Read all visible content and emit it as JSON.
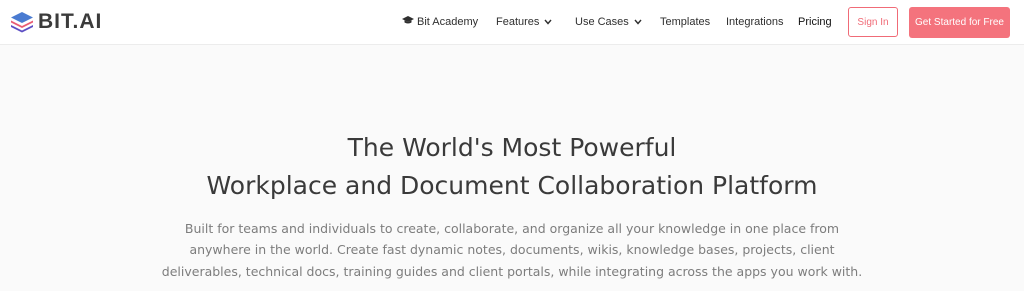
{
  "brand": {
    "logo_text": "BIT.AI"
  },
  "nav": {
    "academy": "Bit Academy",
    "features": "Features",
    "use_cases": "Use Cases",
    "templates": "Templates",
    "integrations": "Integrations",
    "pricing": "Pricing"
  },
  "actions": {
    "sign_in": "Sign In",
    "get_started": "Get Started for Free"
  },
  "hero": {
    "headline_line1": "The World's Most Powerful",
    "headline_line2": "Workplace and Document Collaboration Platform",
    "sub_line1": "Built for teams and individuals to create, collaborate, and organize all your knowledge in one place from",
    "sub_line2": "anywhere in the world. Create fast dynamic notes, documents, wikis, knowledge bases, projects, client",
    "sub_line3": "deliverables, technical docs, training guides and client portals, while integrating across the apps you work with."
  },
  "icons": {
    "logo": "layered-diamond-logo-icon",
    "academy": "graduation-cap-icon",
    "dropdown": "chevron-down-icon"
  },
  "colors": {
    "accent": "#f4737d",
    "accent_border": "#f06b77",
    "heading": "#3a3a3a",
    "body_text": "#7d7d7d",
    "logo_blue": "#4a7bd1",
    "logo_pink": "#e95c74"
  }
}
